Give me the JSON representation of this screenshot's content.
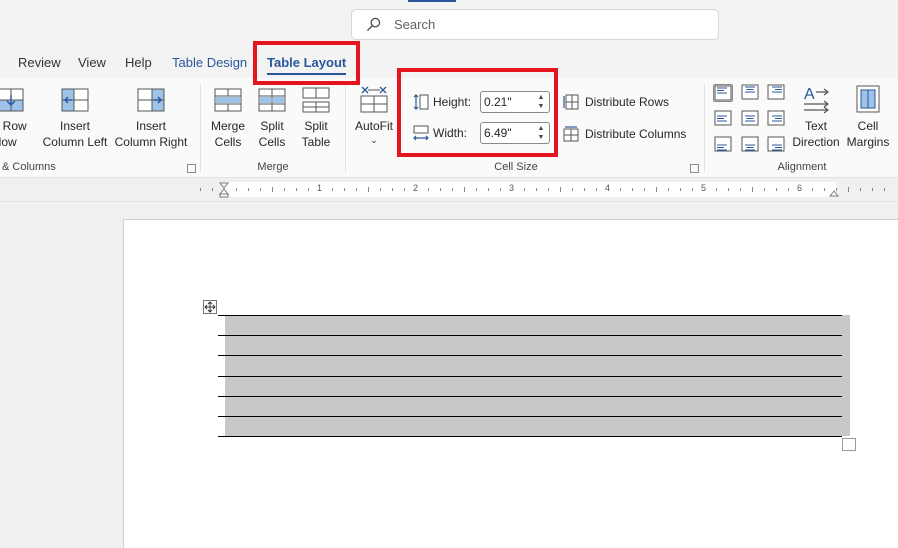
{
  "search": {
    "placeholder": "Search"
  },
  "tabs": [
    {
      "label": "Review"
    },
    {
      "label": "View"
    },
    {
      "label": "Help"
    },
    {
      "label": "Table Design"
    },
    {
      "label": "Table Layout"
    }
  ],
  "rows_columns": {
    "insert_row_below": {
      "line1": "rt Row",
      "line2": "elow"
    },
    "insert_column_left": {
      "line1": "Insert",
      "line2": "Column Left"
    },
    "insert_column_right": {
      "line1": "Insert",
      "line2": "Column Right"
    },
    "group_label": "& Columns"
  },
  "merge": {
    "merge_cells": {
      "line1": "Merge",
      "line2": "Cells"
    },
    "split_cells": {
      "line1": "Split",
      "line2": "Cells"
    },
    "split_table": {
      "line1": "Split",
      "line2": "Table"
    },
    "group_label": "Merge"
  },
  "cell_size": {
    "autofit_label": "AutoFit",
    "height_label": "Height:",
    "height_value": "0.21\"",
    "width_label": "Width:",
    "width_value": "6.49\"",
    "distribute_rows": "Distribute Rows",
    "distribute_columns": "Distribute Columns",
    "group_label": "Cell Size"
  },
  "alignment": {
    "text_direction": {
      "line1": "Text",
      "line2": "Direction"
    },
    "cell_margins": {
      "line1": "Cell",
      "line2": "Margins"
    },
    "group_label": "Alignment"
  },
  "ruler": {
    "numbers": [
      "1",
      "2",
      "3",
      "4",
      "5",
      "6"
    ]
  },
  "colors": {
    "accent": "#2b579a",
    "highlight": "#e4151f",
    "table_shade": "#c8c8c8"
  }
}
